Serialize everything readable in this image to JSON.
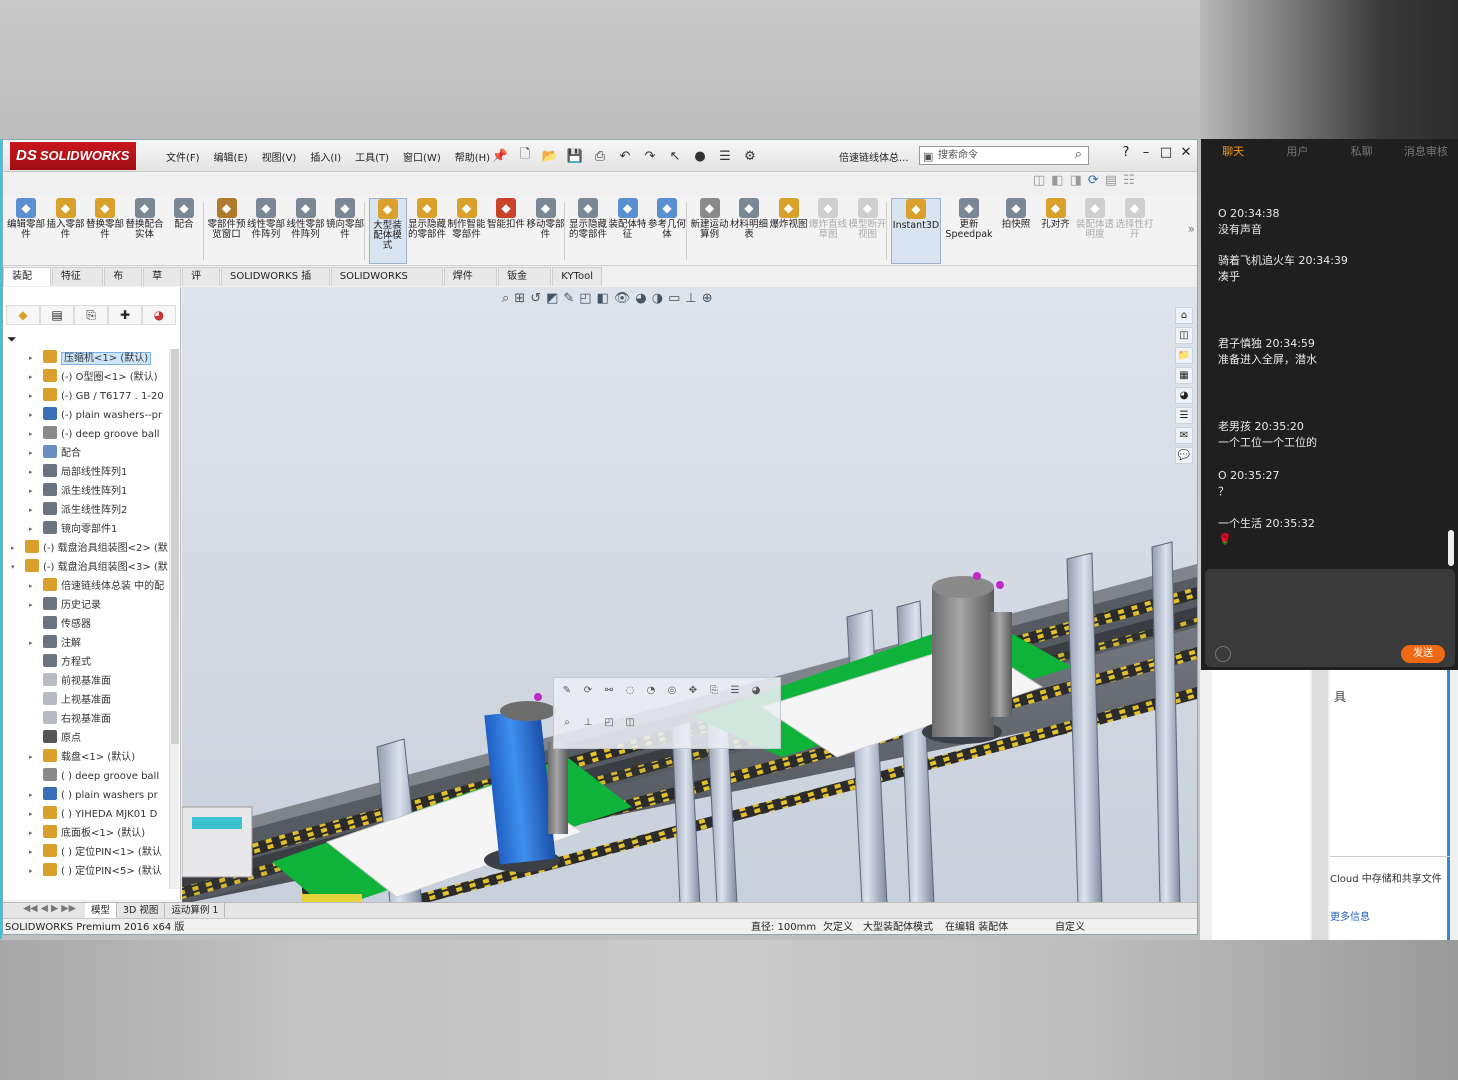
{
  "app": {
    "logo": "SOLIDWORKS",
    "logo_mark": "DS",
    "doc_title": "倍速链线体总...",
    "search_placeholder": "搜索命令"
  },
  "menus": [
    "文件(F)",
    "编辑(E)",
    "视图(V)",
    "插入(I)",
    "工具(T)",
    "窗口(W)",
    "帮助(H)"
  ],
  "commands": [
    {
      "label": "编辑零部件",
      "color": "#5a8fd1"
    },
    {
      "label": "插入零部件",
      "color": "#d9a12b"
    },
    {
      "label": "替换零部件",
      "color": "#d9a12b"
    },
    {
      "label": "替换配合实体",
      "color": "#7a8896"
    },
    {
      "label": "配合",
      "color": "#7a8896"
    },
    {
      "label": "零部件预览窗口",
      "color": "#b07a2c"
    },
    {
      "label": "线性零部件阵列",
      "color": "#7a8896"
    },
    {
      "label": "线性零部件阵列",
      "color": "#7a8896"
    },
    {
      "label": "镜向零部件",
      "color": "#7a8896"
    },
    {
      "label": "大型装配体模式",
      "color": "#d9a12b"
    },
    {
      "label": "显示隐藏的零部件",
      "color": "#d9a12b"
    },
    {
      "label": "制作智能零部件",
      "color": "#d9a12b"
    },
    {
      "label": "智能扣件",
      "color": "#c9432a"
    },
    {
      "label": "移动零部件",
      "color": "#7a8896"
    },
    {
      "label": "显示隐藏的零部件",
      "color": "#7a8896"
    },
    {
      "label": "装配体特征",
      "color": "#5a8fd1"
    },
    {
      "label": "参考几何体",
      "color": "#5a8fd1"
    },
    {
      "label": "新建运动算例",
      "color": "#8a8a8a"
    },
    {
      "label": "材料明细表",
      "color": "#7a8896"
    },
    {
      "label": "爆炸视图",
      "color": "#d9a12b"
    },
    {
      "label": "爆炸直线草图",
      "color": "#cfcfcf"
    },
    {
      "label": "模型断开视图",
      "color": "#cfcfcf"
    },
    {
      "label": "Instant3D",
      "color": "#d9a12b"
    },
    {
      "label": "更新Speedpak",
      "color": "#7a8896"
    },
    {
      "label": "拍快照",
      "color": "#7a8896"
    },
    {
      "label": "孔对齐",
      "color": "#d9a12b"
    },
    {
      "label": "装配体透明度",
      "color": "#cfcfcf"
    },
    {
      "label": "选择性打开",
      "color": "#cfcfcf"
    }
  ],
  "tabs": [
    "装配体",
    "特征(F)",
    "布局",
    "草图",
    "评估",
    "SOLIDWORKS 插件",
    "SOLIDWORKS MBD",
    "焊件(D)",
    "钣金(H)",
    "KYTool"
  ],
  "tree": [
    {
      "label": "压缩机<1> (默认)",
      "indent": 2,
      "exp": "▸",
      "icon": "part",
      "sel": true
    },
    {
      "label": "(-) O型圈<1> (默认)",
      "indent": 2,
      "exp": "▸",
      "icon": "part"
    },
    {
      "label": "(-) GB / T6177 . 1-20",
      "indent": 2,
      "exp": "▸",
      "icon": "part"
    },
    {
      "label": "(-) plain washers--pr",
      "indent": 2,
      "exp": "▸",
      "icon": "washer"
    },
    {
      "label": "(-) deep groove ball",
      "indent": 2,
      "exp": "▸",
      "icon": "bearing"
    },
    {
      "label": "配合",
      "indent": 2,
      "exp": "▸",
      "icon": "mate"
    },
    {
      "label": "局部线性阵列1",
      "indent": 2,
      "exp": "▸",
      "icon": "pattern"
    },
    {
      "label": "派生线性阵列1",
      "indent": 2,
      "exp": "▸",
      "icon": "pattern"
    },
    {
      "label": "派生线性阵列2",
      "indent": 2,
      "exp": "▸",
      "icon": "pattern"
    },
    {
      "label": "镜向零部件1",
      "indent": 2,
      "exp": "▸",
      "icon": "pattern"
    },
    {
      "label": "(-) 载盘治具组装图<2> (默",
      "indent": 1,
      "exp": "▸",
      "icon": "asm"
    },
    {
      "label": "(-) 载盘治具组装图<3> (默",
      "indent": 1,
      "exp": "▾",
      "icon": "asm"
    },
    {
      "label": "倍速链线体总装 中的配",
      "indent": 2,
      "exp": "▸",
      "icon": "part"
    },
    {
      "label": "历史记录",
      "indent": 2,
      "exp": "▸",
      "icon": "hist"
    },
    {
      "label": "传感器",
      "indent": 2,
      "exp": "",
      "icon": "sensor"
    },
    {
      "label": "注解",
      "indent": 2,
      "exp": "▸",
      "icon": "note"
    },
    {
      "label": "方程式",
      "indent": 2,
      "exp": "",
      "icon": "eq"
    },
    {
      "label": "前视基准面",
      "indent": 2,
      "exp": "",
      "icon": "plane"
    },
    {
      "label": "上视基准面",
      "indent": 2,
      "exp": "",
      "icon": "plane"
    },
    {
      "label": "右视基准面",
      "indent": 2,
      "exp": "",
      "icon": "plane"
    },
    {
      "label": "原点",
      "indent": 2,
      "exp": "",
      "icon": "origin"
    },
    {
      "label": "载盘<1> (默认)",
      "indent": 2,
      "exp": "▸",
      "icon": "part"
    },
    {
      "label": "( ) deep groove ball",
      "indent": 2,
      "exp": "",
      "icon": "bearing"
    },
    {
      "label": "( ) plain washers  pr",
      "indent": 2,
      "exp": "▸",
      "icon": "washer"
    },
    {
      "label": "( ) YIHEDA MJK01 D",
      "indent": 2,
      "exp": "▸",
      "icon": "part"
    },
    {
      "label": "底面板<1> (默认)",
      "indent": 2,
      "exp": "▸",
      "icon": "part"
    },
    {
      "label": "( ) 定位PIN<1> (默认",
      "indent": 2,
      "exp": "▸",
      "icon": "part"
    },
    {
      "label": "( ) 定位PIN<5> (默认",
      "indent": 2,
      "exp": "▸",
      "icon": "part"
    }
  ],
  "bottom_tabs": [
    "模型",
    "3D 视图",
    "运动算例 1"
  ],
  "status": {
    "product": "SOLIDWORKS Premium 2016 x64 版",
    "diameter": "直径: 100mm",
    "defined": "欠定义",
    "mode": "大型装配体模式",
    "editing": "在编辑 装配体",
    "custom": "自定义"
  },
  "chat": {
    "tabs": [
      "聊天",
      "用户",
      "私聊",
      "消息审核"
    ],
    "messages": [
      {
        "head": "O 20:34:38",
        "body": "没有声音"
      },
      {
        "head": "骑着飞机追火车 20:34:39",
        "body": "凑乎"
      },
      {
        "head": "君子慎独 20:34:59",
        "body": "准备进入全屏，潜水"
      },
      {
        "head": "老男孩 20:35:20",
        "body": "一个工位一个工位的"
      },
      {
        "head": "O 20:35:27",
        "body": "？"
      },
      {
        "head": "一个生活 20:35:32",
        "body": "🌹"
      }
    ],
    "send": "发送"
  },
  "side_window": {
    "title": "具",
    "cloud": "Cloud 中存储和共享文件",
    "more": "更多信息"
  },
  "colors": {
    "accent": "#f39a1c",
    "send": "#f06a16",
    "sw_red": "#c8161d",
    "selection": "#cde4fa"
  }
}
